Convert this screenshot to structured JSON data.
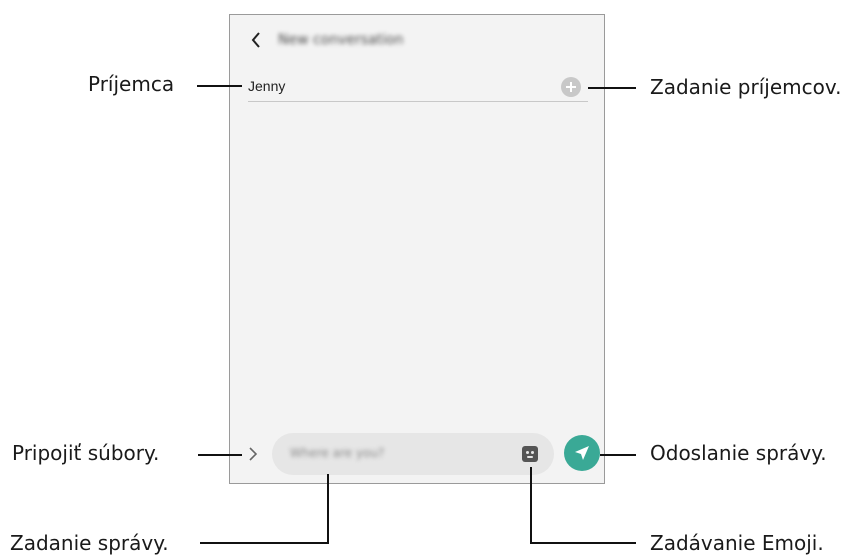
{
  "screen": {
    "back_icon": "chevron-left-icon",
    "title": "New conversation",
    "recipient_value": "Jenny",
    "add_recipient_icon": "plus-circle-icon",
    "attach_icon": "chevron-right-icon",
    "message_placeholder": "Where are you?",
    "emoji_icon": "sticker-icon",
    "send_icon": "send-icon",
    "send_color": "#3aa996"
  },
  "callouts": {
    "recipient": "Príjemca",
    "enter_recipients": "Zadanie príjemcov.",
    "attach_files": "Pripojiť súbory.",
    "send_message": "Odoslanie správy.",
    "enter_message": "Zadanie správy.",
    "enter_emoji": "Zadávanie Emoji."
  }
}
